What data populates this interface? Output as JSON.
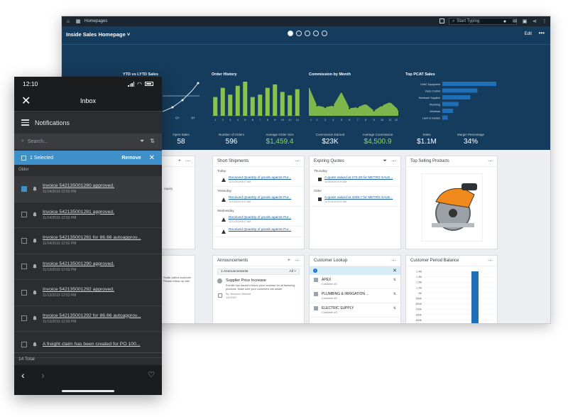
{
  "desktop": {
    "topbar": {
      "title": "Homepages",
      "search_placeholder": "Start Typing"
    },
    "header": {
      "title": "Inside Sales Homepage ˅",
      "edit_label": "Edit",
      "more_label": "•••",
      "carousel_pages": 5,
      "carousel_active": 1
    },
    "charts": {
      "ytd": {
        "title": "YTD vs LYTD Sales",
        "tick_labels": [
          "Q3",
          "Q4"
        ],
        "kpi_label": "Open Sales",
        "kpi_value": "58"
      },
      "order_history": {
        "title": "Order History",
        "tick_labels": [
          "1",
          "2",
          "3",
          "4",
          "5",
          "6",
          "7",
          "8",
          "9",
          "10",
          "11",
          "12"
        ],
        "values": [
          55,
          82,
          62,
          88,
          100,
          55,
          62,
          82,
          92,
          70,
          60,
          78
        ],
        "kpis": [
          {
            "label": "Number of Orders",
            "value": "596",
            "color": "#ffffff"
          },
          {
            "label": "Average Order Size",
            "value": "$1,459.4",
            "color": "#86d95e"
          }
        ]
      },
      "commission": {
        "title": "Commission by Month",
        "tick_labels": [
          "1",
          "2",
          "3",
          "4",
          "5",
          "6",
          "7",
          "8",
          "9",
          "10",
          "11",
          "12"
        ],
        "values": [
          85,
          30,
          25,
          30,
          70,
          22,
          25,
          35,
          15,
          30,
          40,
          18
        ],
        "kpis": [
          {
            "label": "Commission Earned",
            "value": "$23K",
            "color": "#ffffff"
          },
          {
            "label": "Average Commission",
            "value": "$4,500.9",
            "color": "#86d95e"
          }
        ]
      },
      "top_pcat": {
        "title": "Top PCAT Sales",
        "categories": [
          "HVAC Equipment",
          "Voice Control",
          "Hardware Supplies",
          "Plumbing",
          "Windows",
          "Lawn & Garden"
        ],
        "values": [
          100,
          65,
          52,
          30,
          20,
          10
        ],
        "kpis": [
          {
            "label": "Sales",
            "value": "$1.1M",
            "color": "#ffffff"
          },
          {
            "label": "Margin Percentage",
            "value": "34%",
            "color": "#ffffff"
          }
        ]
      }
    },
    "tiles": {
      "short_shipments": {
        "title": "Short Shipments",
        "sections": [
          {
            "label": "Today",
            "items": [
              {
                "text": "Received Quantity of goods against Pur...",
                "sub": "11/14/2019 8:07 AM"
              }
            ]
          },
          {
            "label": "Yesterday",
            "items": [
              {
                "text": "Received Quantity of goods against Pur...",
                "sub": "11/13/2019 8:07 AM"
              }
            ]
          },
          {
            "label": "Wednesday",
            "items": [
              {
                "text": "Received Quantity of goods against Pur...",
                "sub": "11/12/2019 8:07 AM"
              },
              {
                "text": "Received Quantity of goods against Pur...",
                "sub": ""
              }
            ]
          }
        ]
      },
      "expiring_quotes": {
        "title": "Expiring Quotes",
        "sections": [
          {
            "label": "Thursday",
            "items": [
              {
                "text": "A quote valued at 273.28 for METRO SALE...",
                "sub": "11/28/2019 8:00 AM"
              }
            ]
          },
          {
            "label": "Older",
            "items": [
              {
                "text": "A quote valued at 4349.7 for METRO SALE...",
                "sub": "11/21/2019 8:00 AM"
              }
            ]
          }
        ]
      },
      "top_selling": {
        "title": "Top Selling Products"
      },
      "announcements": {
        "title": "Announcements",
        "count_label": "1 Announcements",
        "filter_label": "All ˅",
        "item": {
          "title": "Supplier Price Increase",
          "body": "Everlith has issued a future price increase for all fastening products. Make sure your customers are aware",
          "author": "By: Brandon Stackell",
          "date": "1/4/2020"
        }
      },
      "customer_lookup": {
        "title": "Customer Lookup",
        "customers": [
          {
            "name": "APEX",
            "sub": "Customer #1"
          },
          {
            "name": "PLUMBING & IRRIGATION ...",
            "sub": "Customer #2"
          },
          {
            "name": "ELECTRIC SUPPLY",
            "sub": "Customer #3"
          }
        ]
      },
      "customer_balance": {
        "title": "Customer Period Balance",
        "y_ticks": [
          "1.4M",
          "1.3M",
          "1.2M",
          "1.1M",
          "1M",
          "900K",
          "800K",
          "700K",
          "600K",
          "500K"
        ]
      },
      "left_partial_text": "nquiry",
      "left_partial_text2": "Smith called customer\nPlease follow up with"
    }
  },
  "phone": {
    "time": "12:10",
    "nav_title": "Inbox",
    "section_title": "Notifications",
    "search_placeholder": "Search...",
    "selected_label": "1 Selected",
    "remove_label": "Remove",
    "older_label": "Older",
    "notifications": [
      {
        "text": "Invoice 542135001280 approved.",
        "date": "11/14/2019 12:53 PM",
        "checked": true
      },
      {
        "text": "Invoice 542135001281 approved.",
        "date": "11/14/2019 12:53 PM",
        "checked": false
      },
      {
        "text": "Invoice 542135001281 for 86.66 autoapprov...",
        "date": "11/14/2019 12:52 PM",
        "checked": false
      },
      {
        "text": "Invoice 542135001290 approved.",
        "date": "11/13/2019 12:53 PM",
        "checked": false
      },
      {
        "text": "Invoice 542135001292 approved.",
        "date": "11/13/2019 12:53 PM",
        "checked": false
      },
      {
        "text": "Invoice 542135001292 for 86.66 autoapprov...",
        "date": "11/13/2019 12:53 PM",
        "checked": false
      },
      {
        "text": "A freight claim has been created for PO 100...",
        "date": "",
        "checked": false
      }
    ],
    "total_label": "14 Total"
  },
  "colors": {
    "hero_bg": "#153c5c",
    "bar_green": "#8bc34a",
    "bar_blue": "#1e6fb8",
    "phone_bg": "#2b2d30",
    "accent_blue": "#3f8fc8"
  }
}
